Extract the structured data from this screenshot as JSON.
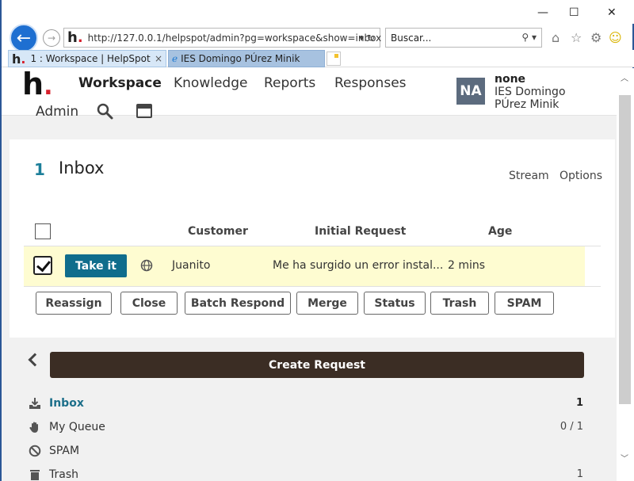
{
  "browser": {
    "url": "http://127.0.0.1/helpspot/admin?pg=workspace&show=inbox",
    "search_placeholder": "Buscar...",
    "tabs": [
      {
        "label": "1 : Workspace | HelpSpot",
        "close": "×"
      },
      {
        "label": "IES Domingo PÚrez Minik"
      }
    ],
    "window_controls": {
      "minimize": "—",
      "maximize": "☐",
      "close": "✕"
    }
  },
  "header": {
    "logo": "h",
    "logo_dot": ".",
    "nav": [
      "Workspace",
      "Knowledge",
      "Reports",
      "Responses",
      "Admin"
    ],
    "active_nav": "Workspace",
    "user": {
      "initials": "NA",
      "name": "none",
      "org": "IES Domingo PÚrez Minik"
    }
  },
  "inbox": {
    "count": "1",
    "title": "Inbox",
    "stream_label": "Stream",
    "options_label": "Options",
    "columns": [
      "Customer",
      "Initial Request",
      "Age"
    ],
    "rows": [
      {
        "take_label": "Take it",
        "customer": "Juanito",
        "request": "Me ha surgido un error instal...",
        "age": "2 mins",
        "checked": true
      }
    ],
    "actions": [
      "Reassign",
      "Close",
      "Batch Respond",
      "Merge",
      "Status",
      "Trash",
      "SPAM"
    ]
  },
  "sidebar": {
    "create_label": "Create Request",
    "queues": [
      {
        "label": "Inbox",
        "count": "1",
        "icon": "inbox-download-icon"
      },
      {
        "label": "My Queue",
        "count": "0 / 1",
        "icon": "hand-icon"
      },
      {
        "label": "SPAM",
        "count": "",
        "icon": "ban-icon"
      },
      {
        "label": "Trash",
        "count": "1",
        "icon": "trash-icon"
      }
    ]
  }
}
